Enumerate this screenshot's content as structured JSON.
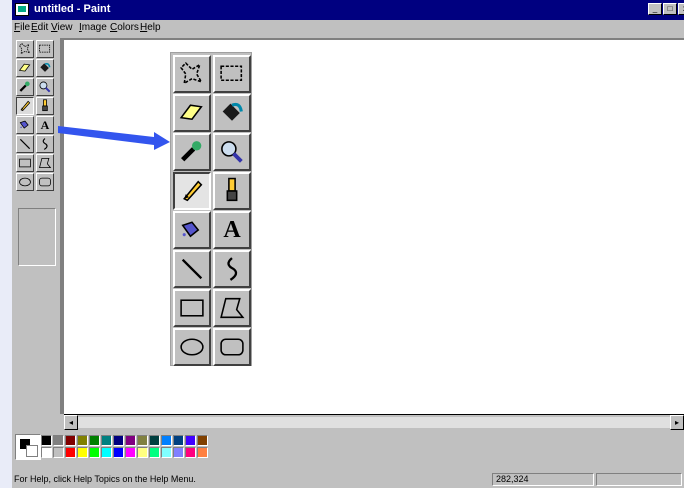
{
  "window": {
    "title": "untitled - Paint"
  },
  "title_buttons": [
    {
      "icon": "minimize-icon",
      "glyph": "_"
    },
    {
      "icon": "maximize-icon",
      "glyph": "□"
    },
    {
      "icon": "close-icon",
      "glyph": "x"
    }
  ],
  "menu": [
    "File",
    "Edit",
    "View",
    "Image",
    "Colors",
    "Help"
  ],
  "tools": [
    {
      "name": "free-form-select",
      "icon": "free-form-select-icon"
    },
    {
      "name": "select",
      "icon": "select-icon"
    },
    {
      "name": "eraser",
      "icon": "eraser-icon"
    },
    {
      "name": "fill-with-color",
      "icon": "fill-bucket-icon"
    },
    {
      "name": "pick-color",
      "icon": "eyedropper-icon"
    },
    {
      "name": "magnifier",
      "icon": "magnifier-icon"
    },
    {
      "name": "pencil",
      "icon": "pencil-icon",
      "selected": true
    },
    {
      "name": "brush",
      "icon": "brush-icon"
    },
    {
      "name": "airbrush",
      "icon": "airbrush-icon"
    },
    {
      "name": "text",
      "icon": "text-icon",
      "glyph": "A"
    },
    {
      "name": "line",
      "icon": "line-icon"
    },
    {
      "name": "curve",
      "icon": "curve-icon"
    },
    {
      "name": "rectangle",
      "icon": "rectangle-icon"
    },
    {
      "name": "polygon",
      "icon": "polygon-icon"
    },
    {
      "name": "ellipse",
      "icon": "ellipse-icon"
    },
    {
      "name": "rounded-rectangle",
      "icon": "rounded-rectangle-icon"
    }
  ],
  "colors": {
    "foreground": "#000000",
    "background": "#ffffff",
    "palette_top": [
      "#000000",
      "#808080",
      "#800000",
      "#808000",
      "#008000",
      "#008080",
      "#000080",
      "#800080",
      "#808040",
      "#004040",
      "#0080ff",
      "#004080",
      "#4000ff",
      "#804000"
    ],
    "palette_bottom": [
      "#ffffff",
      "#c0c0c0",
      "#ff0000",
      "#ffff00",
      "#00ff00",
      "#00ffff",
      "#0000ff",
      "#ff00ff",
      "#ffff80",
      "#00ff80",
      "#80ffff",
      "#8080ff",
      "#ff0080",
      "#ff8040"
    ]
  },
  "scrollbar": {
    "left": "◂",
    "right": "▸"
  },
  "status": {
    "message": "For Help, click Help Topics on the Help Menu.",
    "coords": "282,324"
  },
  "callout_color": "#3355ee"
}
